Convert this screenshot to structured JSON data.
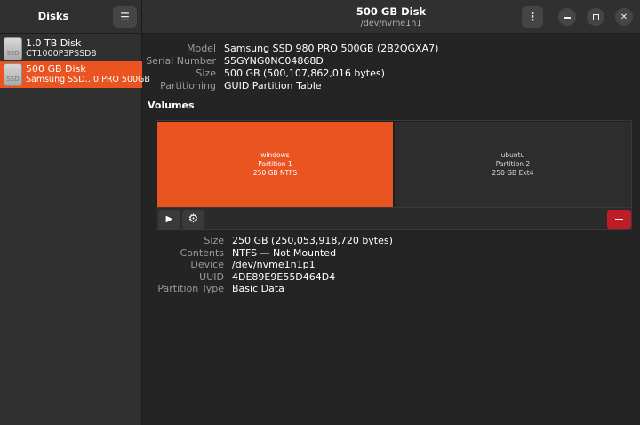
{
  "sidebar": {
    "title": "Disks",
    "menu_icon": "hamburger-icon",
    "disks": [
      {
        "name": "1.0 TB Disk",
        "subtitle": "CT1000P3PSSD8",
        "icon_label": "SSD",
        "selected": false
      },
      {
        "name": "500 GB Disk",
        "subtitle": "Samsung SSD…0 PRO 500GB",
        "icon_label": "SSD",
        "selected": true
      }
    ]
  },
  "header": {
    "title": "500 GB Disk",
    "subtitle": "/dev/nvme1n1",
    "kebab": "⋮",
    "minimize_icon": "minimize-icon",
    "maximize_icon": "maximize-icon",
    "close_icon": "close-icon",
    "close_glyph": "✕"
  },
  "disk_info": {
    "model_label": "Model",
    "model": "Samsung SSD 980 PRO 500GB (2B2QGXA7)",
    "serial_label": "Serial Number",
    "serial": "S5GYNG0NC04868D",
    "size_label": "Size",
    "size": "500 GB (500,107,862,016 bytes)",
    "partitioning_label": "Partitioning",
    "partitioning": "GUID Partition Table"
  },
  "volumes": {
    "title": "Volumes",
    "partitions": [
      {
        "name": "windows",
        "number": "Partition 1",
        "detail": "250 GB NTFS",
        "selected": true
      },
      {
        "name": "ubuntu",
        "number": "Partition 2",
        "detail": "250 GB Ext4",
        "selected": false
      }
    ],
    "toolbar": {
      "play_glyph": "▶",
      "gear_glyph": "⚙"
    }
  },
  "partition_info": {
    "size_label": "Size",
    "size": "250 GB (250,053,918,720 bytes)",
    "contents_label": "Contents",
    "contents": "NTFS — Not Mounted",
    "device_label": "Device",
    "device": "/dev/nvme1n1p1",
    "uuid_label": "UUID",
    "uuid": "4DE89E9E55D464D4",
    "type_label": "Partition Type",
    "type": "Basic Data"
  },
  "colors": {
    "accent": "#e95420",
    "destructive": "#c01c28",
    "background": "#242424",
    "sidebar": "#303030"
  }
}
